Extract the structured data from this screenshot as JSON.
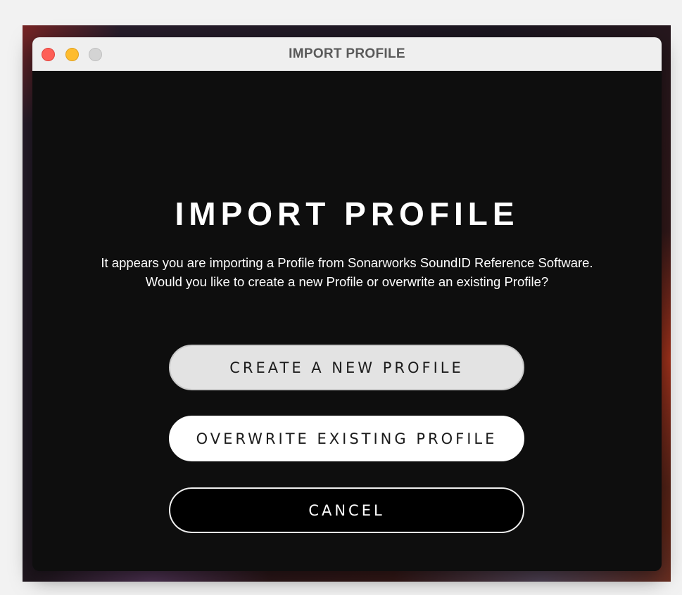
{
  "window": {
    "title": "IMPORT PROFILE",
    "controls": [
      "close",
      "minimize",
      "zoom"
    ]
  },
  "dialog": {
    "heading": "IMPORT PROFILE",
    "description": "It appears you are importing a Profile from Sonarworks SoundID Reference Software. Would you like to create a new Profile or overwrite an existing Profile?",
    "buttons": {
      "create_label": "CREATE A NEW PROFILE",
      "overwrite_label": "OVERWRITE EXISTING PROFILE",
      "cancel_label": "CANCEL"
    }
  },
  "colors": {
    "close": "#fe5f57",
    "minimize": "#febc2e",
    "zoom": "#d4d4d4",
    "dialog_background": "#0e0e0e"
  }
}
